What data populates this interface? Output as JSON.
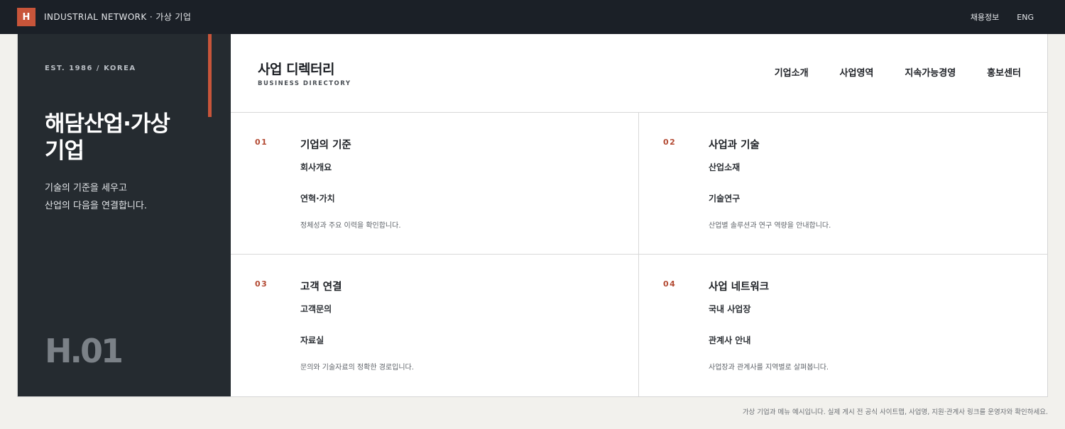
{
  "topbar": {
    "logo": "H",
    "brand": "INDUSTRIAL NETWORK · 가상 기업",
    "links": [
      "채용정보",
      "ENG"
    ]
  },
  "sidebar": {
    "est": "EST. 1986 / KOREA",
    "title": "해담산업·가상 기업",
    "desc_line1": "기술의 기준을 세우고",
    "desc_line2": "산업의 다음을 연결합니다.",
    "code": "H.01"
  },
  "header": {
    "title": "사업 디렉터리",
    "subtitle": "BUSINESS DIRECTORY",
    "nav": [
      "기업소개",
      "사업영역",
      "지속가능경영",
      "홍보센터"
    ]
  },
  "sections": [
    {
      "num": "01",
      "title": "기업의 기준",
      "link1": "회사개요",
      "link2": "연혁·가치",
      "desc": "정체성과 주요 이력을 확인합니다."
    },
    {
      "num": "02",
      "title": "사업과 기술",
      "link1": "산업소재",
      "link2": "기술연구",
      "desc": "산업별 솔루션과 연구 역량을 안내합니다."
    },
    {
      "num": "03",
      "title": "고객 연결",
      "link1": "고객문의",
      "link2": "자료실",
      "desc": "문의와 기술자료의 정확한 경로입니다."
    },
    {
      "num": "04",
      "title": "사업 네트워크",
      "link1": "국내 사업장",
      "link2": "관계사 안내",
      "desc": "사업장과 관계사를 지역별로 살펴봅니다."
    }
  ],
  "footer": {
    "note": "가상 기업과 메뉴 예시입니다. 실제 게시 전 공식 사이트맵, 사업명, 지원·관계사 링크를 운영자와 확인하세요."
  },
  "colors": {
    "accent": "#c8553a",
    "topbar": "#1b2027",
    "sidebar": "#252b30"
  }
}
